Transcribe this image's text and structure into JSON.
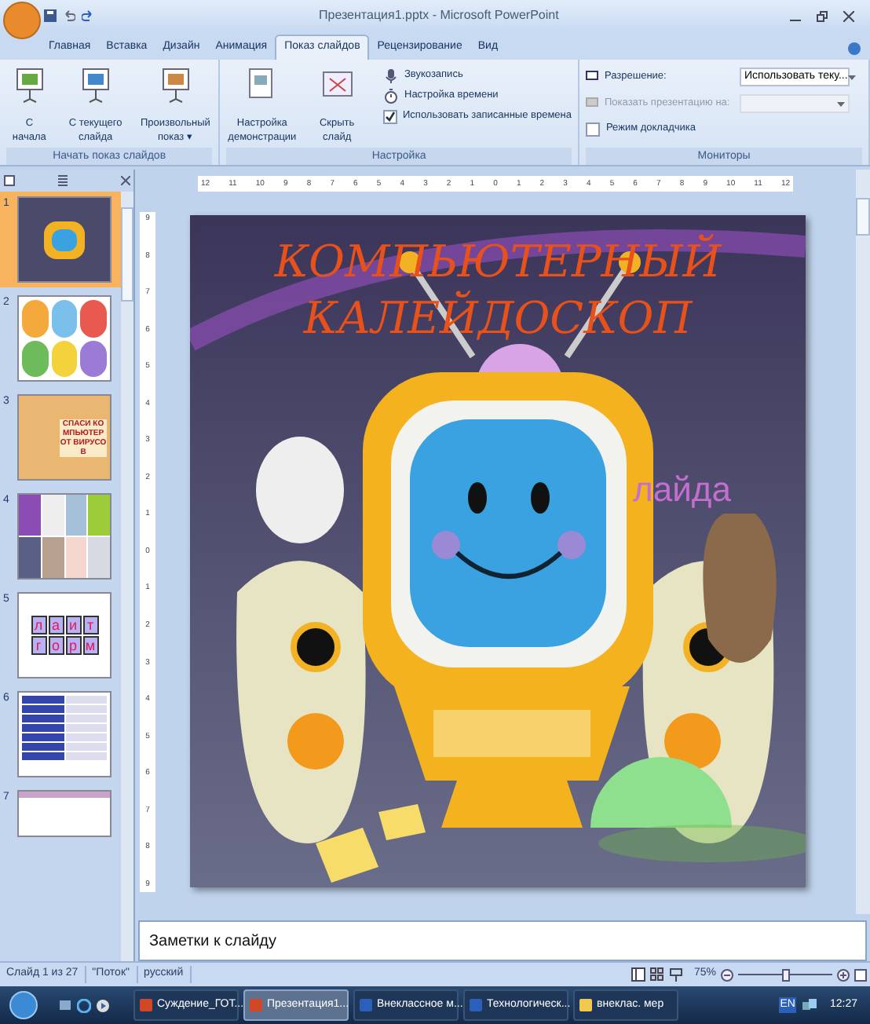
{
  "window": {
    "title": "Презентация1.pptx - Microsoft PowerPoint"
  },
  "tabs": [
    {
      "label": "Главная",
      "selected": false
    },
    {
      "label": "Вставка",
      "selected": false
    },
    {
      "label": "Дизайн",
      "selected": false
    },
    {
      "label": "Анимация",
      "selected": false
    },
    {
      "label": "Показ слайдов",
      "selected": true
    },
    {
      "label": "Рецензирование",
      "selected": false
    },
    {
      "label": "Вид",
      "selected": false
    }
  ],
  "groups": [
    {
      "label": "Начать показ слайдов",
      "buttons": [
        {
          "label": "С начала",
          "kind": "play"
        },
        {
          "label": "С текущего слайда",
          "kind": "current"
        },
        {
          "label": "Произвольный показ ▾",
          "kind": "custom"
        }
      ]
    },
    {
      "label": "Настройка",
      "buttons": [
        {
          "label": "Настройка демонстрации",
          "kind": "setup"
        },
        {
          "label": "Скрыть слайд",
          "kind": "hide"
        }
      ],
      "options": [
        {
          "label": "Звукозапись",
          "kind": "mic"
        },
        {
          "label": "Настройка времени",
          "kind": "timer"
        },
        {
          "label": "Использовать записанные времена",
          "kind": "check",
          "checked": true
        }
      ]
    },
    {
      "label": "Мониторы",
      "fields": [
        {
          "label": "Разрешение:",
          "value": "Использовать теку...",
          "disabled": false
        },
        {
          "label": "Показать презентацию на:",
          "disabled": true
        }
      ],
      "options": [
        {
          "label": "Режим докладчика",
          "kind": "check",
          "checked": false
        }
      ]
    }
  ],
  "hruler": [
    "12",
    "11",
    "10",
    "9",
    "8",
    "7",
    "6",
    "5",
    "4",
    "3",
    "2",
    "1",
    "0",
    "1",
    "2",
    "3",
    "4",
    "5",
    "6",
    "7",
    "8",
    "9",
    "10",
    "11",
    "12"
  ],
  "vruler": [
    "9",
    "8",
    "7",
    "6",
    "5",
    "4",
    "3",
    "2",
    "1",
    "0",
    "1",
    "2",
    "3",
    "4",
    "5",
    "6",
    "7",
    "8",
    "9"
  ],
  "slides": [
    {
      "number": "1",
      "selected": true,
      "kind": "robot"
    },
    {
      "number": "2",
      "selected": false,
      "kind": "collage"
    },
    {
      "number": "3",
      "selected": false,
      "kind": "virus",
      "text": "СПАСИ КОМПЬЮТЕР ОТ ВИРУСОВ"
    },
    {
      "number": "4",
      "selected": false,
      "kind": "grid"
    },
    {
      "number": "5",
      "selected": false,
      "kind": "letters",
      "rows": [
        [
          "л",
          "а",
          "и",
          "т"
        ],
        [
          "г",
          "о",
          "р",
          "м"
        ]
      ]
    },
    {
      "number": "6",
      "selected": false,
      "kind": "table"
    },
    {
      "number": "7",
      "selected": false,
      "kind": "partial"
    }
  ],
  "slide": {
    "title_lines": [
      "КОМПЬЮТЕРНЫЙ",
      "КАЛЕЙДОСКОП"
    ],
    "placeholder_fragment": "лайда"
  },
  "notes": {
    "placeholder": "Заметки к слайду"
  },
  "status_bar": {
    "items": [
      "Слайд 1 из 27",
      "\"Поток\"",
      "русский"
    ],
    "zoom": "75%",
    "level": 0.5
  },
  "taskbar": {
    "items": [
      {
        "label": "Суждение_ГОТ...",
        "selected": false,
        "kind": "ppt"
      },
      {
        "label": "Презентация1...",
        "selected": true,
        "kind": "ppt"
      },
      {
        "label": "Внеклассное м...",
        "selected": false,
        "kind": "doc"
      },
      {
        "label": "Технологическ...",
        "selected": false,
        "kind": "doc"
      },
      {
        "label": "внеклас. мер",
        "selected": false,
        "kind": "folder"
      }
    ],
    "language": "EN",
    "time": "12:27"
  }
}
